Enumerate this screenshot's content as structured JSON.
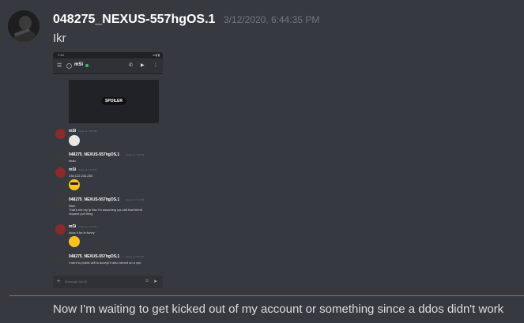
{
  "message1": {
    "username": "048275_NEXUS-557hgOS.1",
    "timestamp": "3/12/2020, 6:44:35 PM",
    "text": "Ikr"
  },
  "screenshot": {
    "status_time": "7:44",
    "status_icons": "◂ ▮ ▮",
    "channel_name": "mSi",
    "spoiler_label": "SPOILER",
    "input_placeholder": "Message @mSi",
    "messages": [
      {
        "user": "mSi",
        "time": "Today at 7:38 PM",
        "text": "",
        "emoji": "troll"
      },
      {
        "user": "048275_NEXUS-557hgOS.1",
        "time": "Today at 7:39 PM",
        "text": "lmao",
        "emoji": ""
      },
      {
        "user": "mSi",
        "time": "Today at 7:40 PM",
        "text": "138.122.234.253",
        "emoji": "sunglasses"
      },
      {
        "user": "048275_NEXUS-557hgOS.1",
        "time": "Today at 7:41 PM",
        "text": "Nice",
        "text2": "That's not my ip btw I'm assuming you did that friend",
        "text3": "request pull thing",
        "emoji": ""
      },
      {
        "user": "mSi",
        "time": "Today at 7:41 PM",
        "text": "ddos it for le funny",
        "emoji": "relieved"
      },
      {
        "user": "048275_NEXUS-557hgOS.1",
        "time": "Today at 7:42 PM",
        "text": "I went to public wifi to accept it also turned on a vpn",
        "emoji": ""
      }
    ]
  },
  "message2": {
    "text": "Now I'm waiting to get kicked out of my account or something  since a ddos didn't work"
  },
  "colors": {
    "background": "#36393f",
    "username": "#ffffff",
    "timestamp": "#72767d",
    "new_divider": "#f04747"
  }
}
